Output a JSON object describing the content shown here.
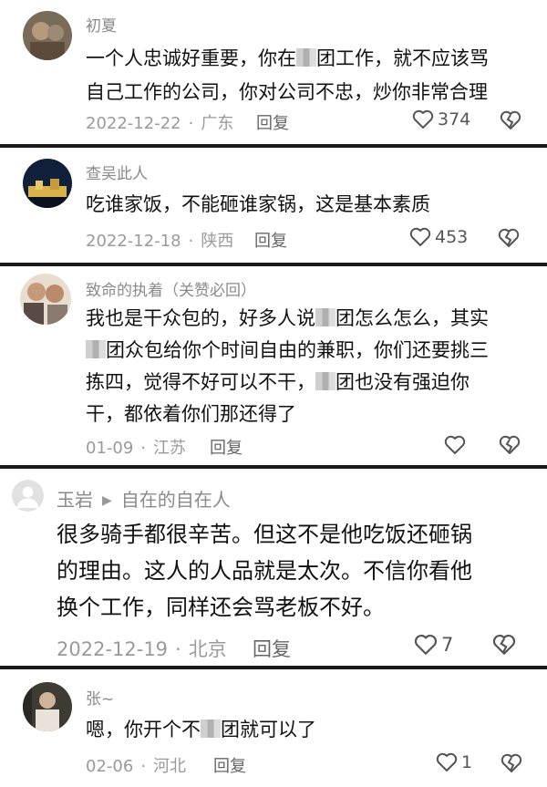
{
  "comments": [
    {
      "name": "初夏",
      "lines": [
        "一个人忠诚好重要，你在",
        "团工作，就不应该骂",
        "自己工作的公司，你对公司不忠，炒你非常合理"
      ],
      "date": "2022-12-22",
      "location": "广东",
      "reply": "回复",
      "likes": "374"
    },
    {
      "name": "查吴此人",
      "lines": [
        "吃谁家饭，不能砸谁家锅，这是基本素质"
      ],
      "date": "2022-12-18",
      "location": "陕西",
      "reply": "回复",
      "likes": "453"
    },
    {
      "name": "致命的执着（关赞必回）",
      "lines": [
        "我也是干众包的，好多人说",
        "团怎么怎么，其实",
        "团众包给你个时间自由的兼职，你们还要挑三",
        "拣四，觉得不好可以不干，",
        "团也没有强迫你",
        "干，都依着你们那还得了"
      ],
      "date": "01-09",
      "location": "江苏",
      "reply": "回复",
      "likes": ""
    },
    {
      "name": "玉岩",
      "reply_to": "自在的自在人",
      "lines": [
        "很多骑手都很辛苦。但这不是他吃饭还砸锅",
        "的理由。这人的人品就是太次。不信你看他",
        "换个工作，同样还会骂老板不好。"
      ],
      "date": "2022-12-19",
      "location": "北京",
      "reply": "回复",
      "likes": "7"
    },
    {
      "name": "张~",
      "lines": [
        "嗯，你开个不",
        "团就可以了"
      ],
      "date": "02-06",
      "location": "河北",
      "reply": "回复",
      "likes": "1"
    }
  ],
  "colors": {
    "text": "#111111",
    "muted": "#9a9a9a",
    "divider": "#1a1a1a"
  },
  "icons": [
    "heart-outline-icon",
    "heart-broken-icon",
    "triangle-right-icon"
  ]
}
